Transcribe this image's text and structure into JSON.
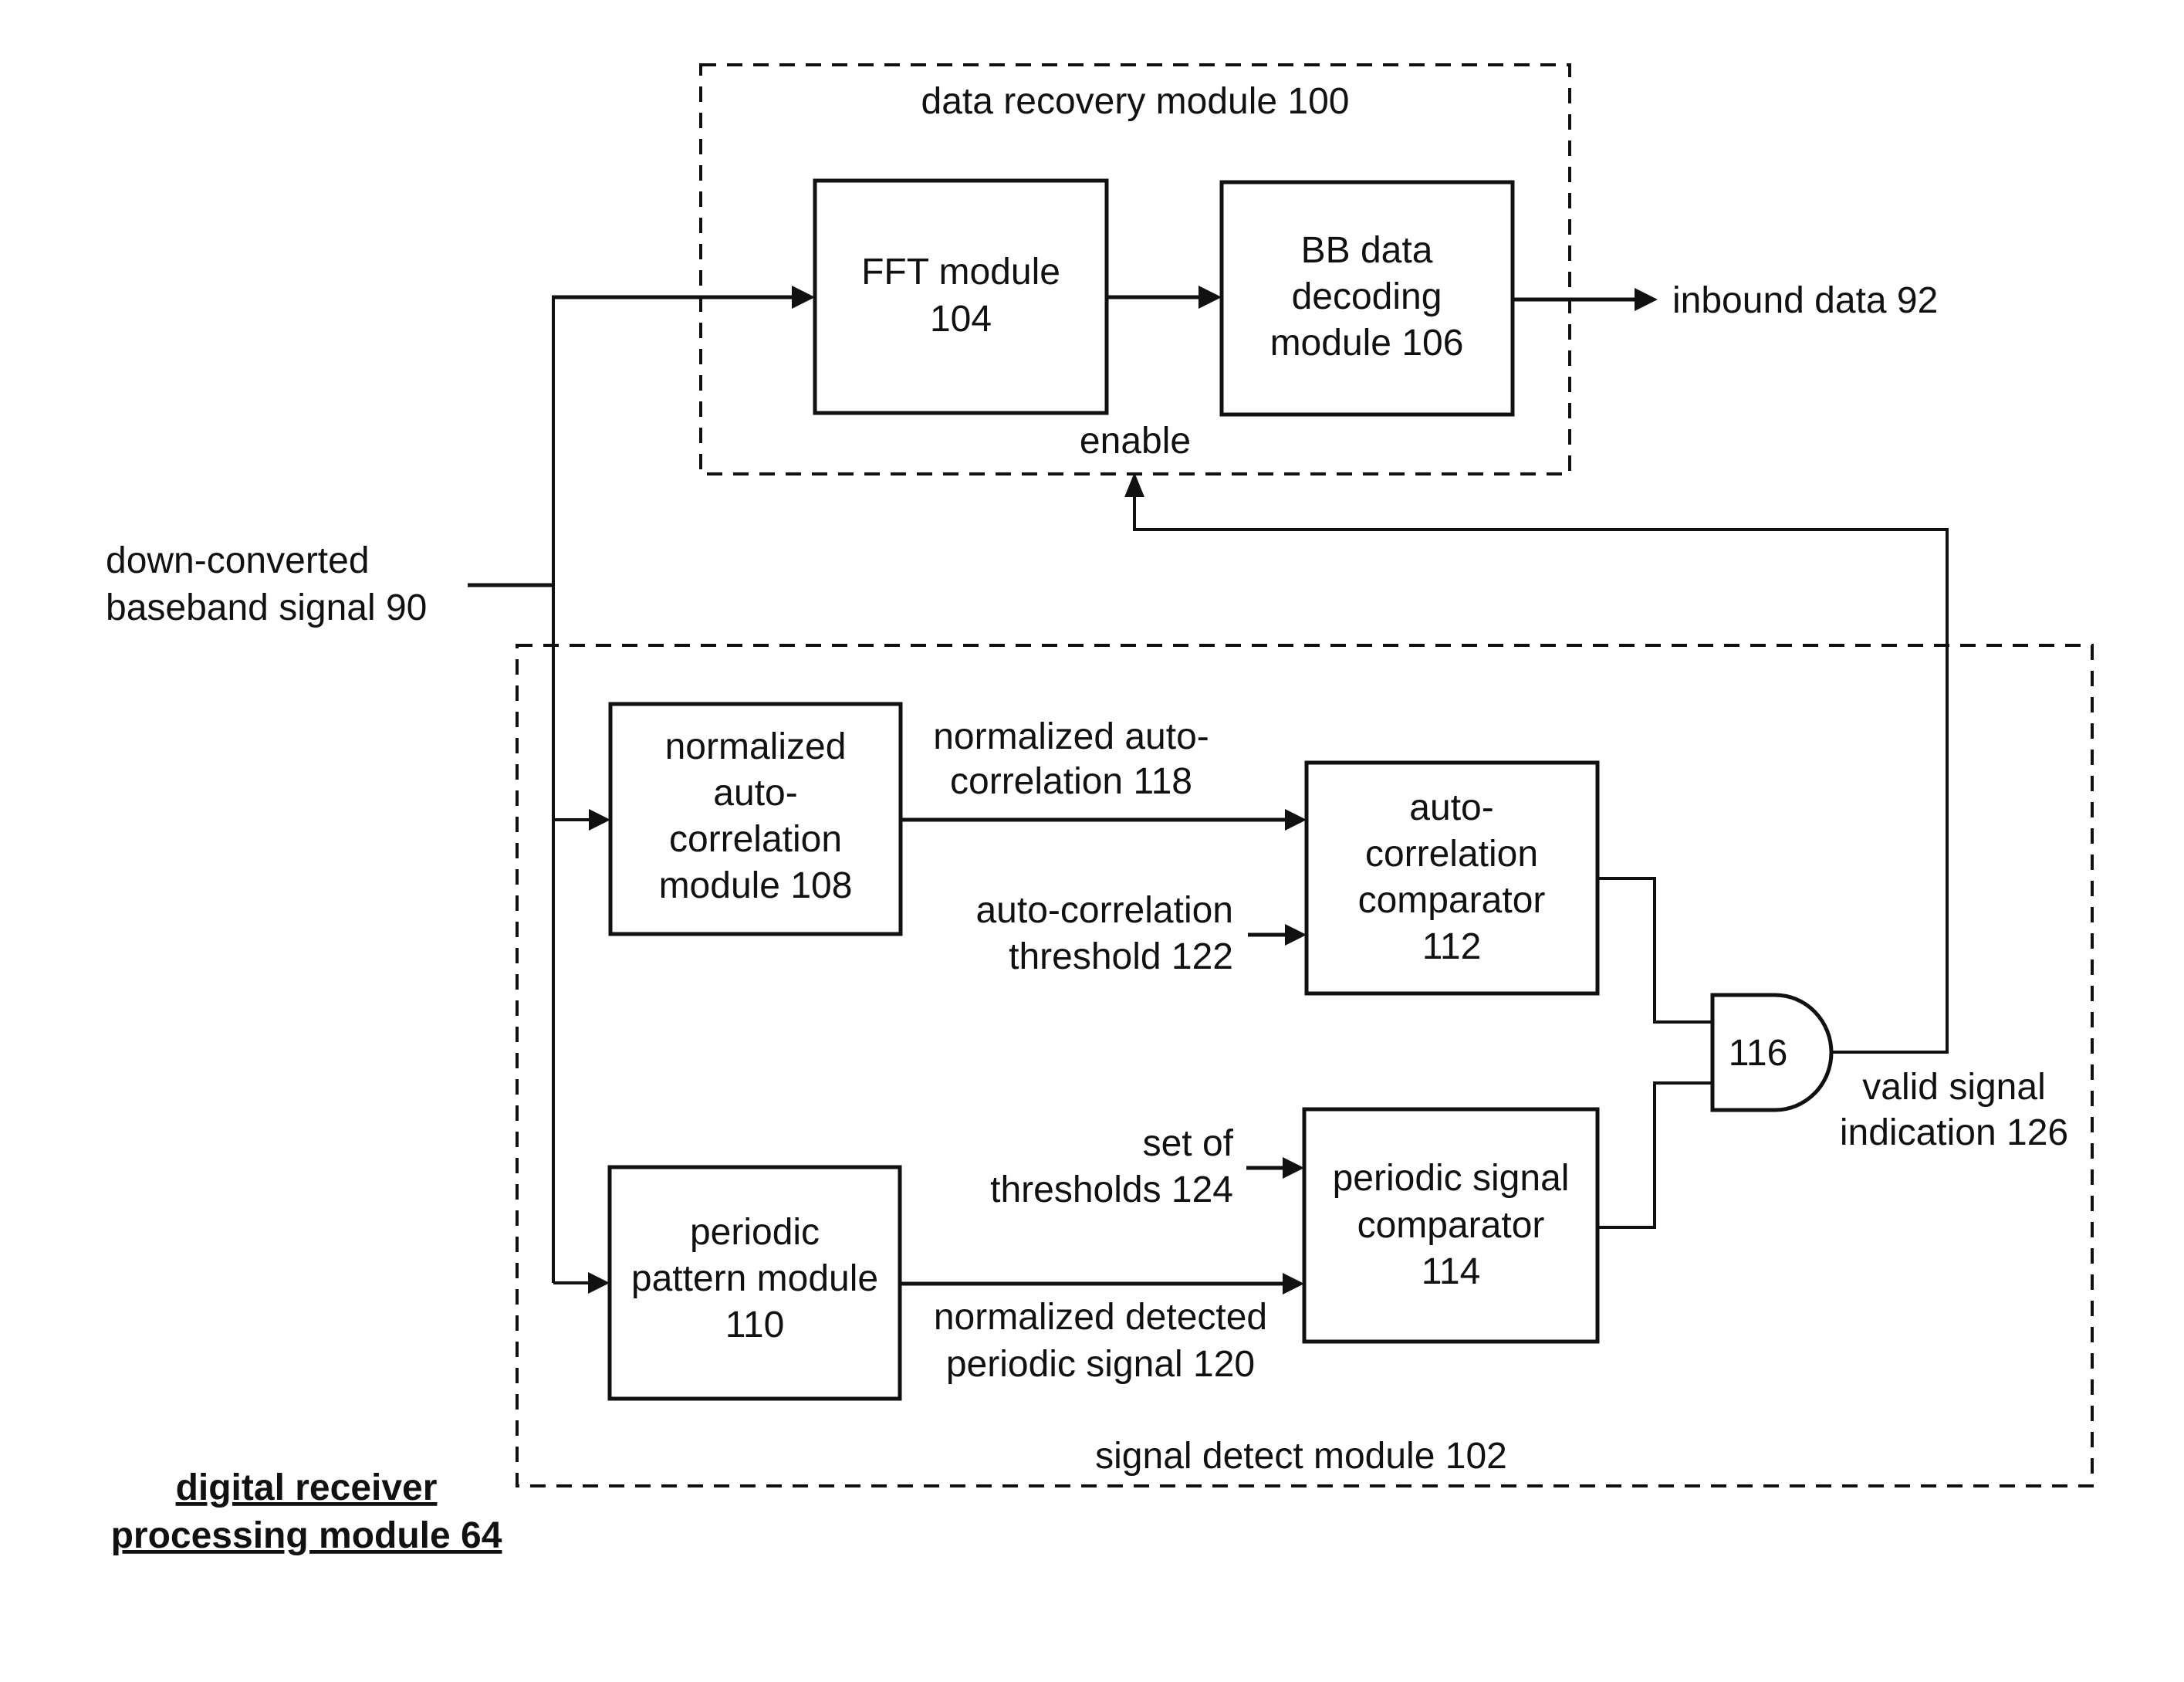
{
  "diagram": {
    "title_lines": [
      "digital receiver",
      "processing module 64"
    ],
    "groups": {
      "data_recovery": {
        "label": "data recovery module 100"
      },
      "signal_detect": {
        "label": "signal detect module 102"
      }
    },
    "blocks": {
      "fft": {
        "lines": [
          "FFT module",
          "104"
        ]
      },
      "bb_decoding": {
        "lines": [
          "BB data",
          "decoding",
          "module 106"
        ]
      },
      "norm_autocorr": {
        "lines": [
          "normalized",
          "auto-",
          "correlation",
          "module 108"
        ]
      },
      "periodic_pattern": {
        "lines": [
          "periodic",
          "pattern module",
          "110"
        ]
      },
      "autocorr_comparator": {
        "lines": [
          "auto-",
          "correlation",
          "comparator",
          "112"
        ]
      },
      "periodic_comparator": {
        "lines": [
          "periodic signal",
          "comparator",
          "114"
        ]
      },
      "and_gate": {
        "label": "116",
        "type": "AND gate"
      }
    },
    "signals": {
      "input": {
        "lines": [
          "down-converted",
          "baseband signal 90"
        ]
      },
      "output": {
        "label": "inbound data 92"
      },
      "enable": {
        "label": "enable"
      },
      "autocorr_118": {
        "lines": [
          "normalized auto-",
          "correlation 118"
        ]
      },
      "threshold_122": {
        "lines": [
          "auto-correlation",
          "threshold 122"
        ]
      },
      "thresholds_124": {
        "lines": [
          "set of",
          "thresholds 124"
        ]
      },
      "periodic_120": {
        "lines": [
          "normalized detected",
          "periodic signal 120"
        ]
      },
      "valid_126": {
        "lines": [
          "valid signal",
          "indication 126"
        ]
      }
    },
    "connections": [
      {
        "from": "input",
        "to": "fft"
      },
      {
        "from": "fft",
        "to": "bb_decoding"
      },
      {
        "from": "bb_decoding",
        "to": "output"
      },
      {
        "from": "input",
        "to": "norm_autocorr"
      },
      {
        "from": "input",
        "to": "periodic_pattern"
      },
      {
        "from": "norm_autocorr",
        "to": "autocorr_comparator",
        "signal": "autocorr_118"
      },
      {
        "from": "threshold_122",
        "to": "autocorr_comparator"
      },
      {
        "from": "periodic_pattern",
        "to": "periodic_comparator",
        "signal": "periodic_120"
      },
      {
        "from": "thresholds_124",
        "to": "periodic_comparator"
      },
      {
        "from": "autocorr_comparator",
        "to": "and_gate"
      },
      {
        "from": "periodic_comparator",
        "to": "and_gate"
      },
      {
        "from": "and_gate",
        "to": "data_recovery",
        "signal": "valid_126",
        "port": "enable"
      }
    ]
  }
}
